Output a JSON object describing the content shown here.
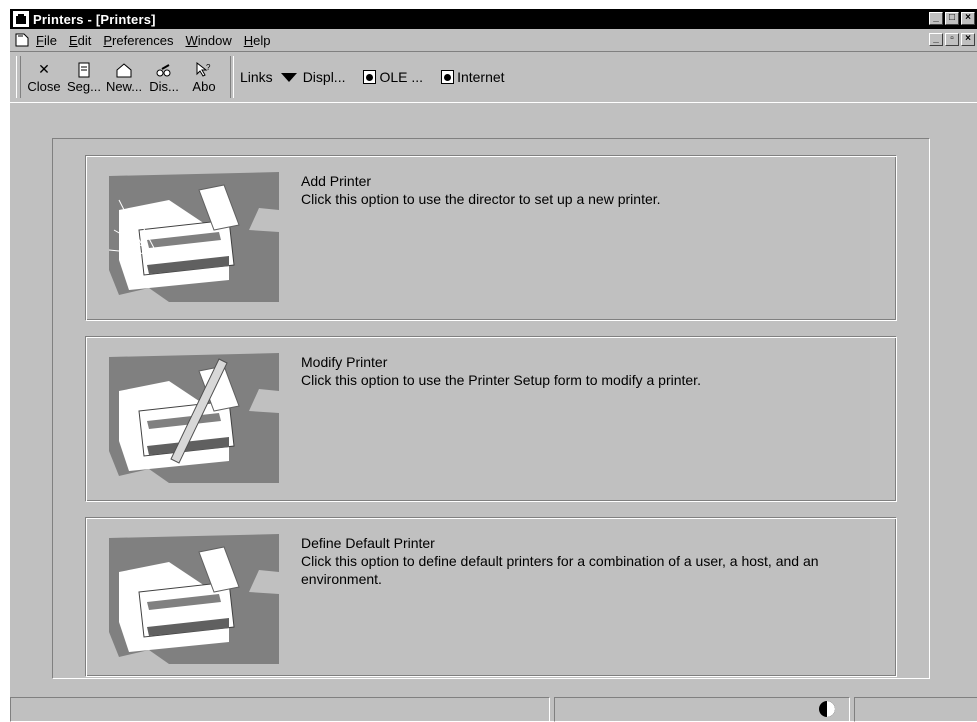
{
  "window": {
    "title": "Printers - [Printers]"
  },
  "menu": [
    {
      "key": "F",
      "rest": "ile"
    },
    {
      "key": "E",
      "rest": "dit"
    },
    {
      "key": "P",
      "rest": "references"
    },
    {
      "key": "W",
      "rest": "indow"
    },
    {
      "key": "H",
      "rest": "elp"
    }
  ],
  "toolbar": {
    "buttons": [
      {
        "label": "Close",
        "icon": "close-icon"
      },
      {
        "label": "Seg...",
        "icon": "segment-icon"
      },
      {
        "label": "New...",
        "icon": "new-icon"
      },
      {
        "label": "Dis...",
        "icon": "display-icon"
      },
      {
        "label": "Abo",
        "icon": "about-icon"
      }
    ],
    "links_label": "Links",
    "display_label": "Displ...",
    "ole_label": "OLE ...",
    "internet_label": "Internet"
  },
  "options": [
    {
      "title": "Add Printer",
      "desc": "Click this option to use the director to set up a new printer.",
      "icon": "add-printer-icon"
    },
    {
      "title": "Modify Printer",
      "desc": "Click this option to use the Printer Setup form to modify a printer.",
      "icon": "modify-printer-icon"
    },
    {
      "title": "Define Default Printer",
      "desc": "Click this option to define default printers for a combination of a user, a host, and an environment.",
      "icon": "default-printer-icon"
    }
  ],
  "colors": {
    "face": "#c0c0c0",
    "titlebar": "#000000",
    "shadow": "#808080",
    "highlight": "#ffffff"
  }
}
